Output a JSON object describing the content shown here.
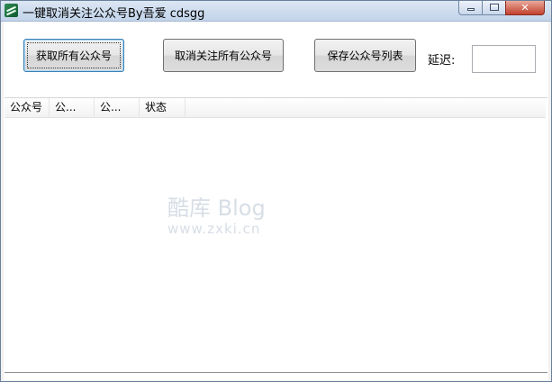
{
  "window": {
    "title": "一键取消关注公众号By吾爱 cdsgg",
    "controls": {
      "minimize": "minimize",
      "maximize": "maximize",
      "close": "close"
    }
  },
  "toolbar": {
    "fetch_button": "获取所有公众号",
    "unfollow_button": "取消关注所有公众号",
    "save_button": "保存公众号列表",
    "delay_label": "延迟:",
    "delay_value": ""
  },
  "list": {
    "columns": [
      "公众号",
      "公...",
      "公...",
      "状态"
    ],
    "rows": []
  },
  "watermark": {
    "brand": "酷库 Blog",
    "url": "www.zxki.cn"
  },
  "icons": {
    "app": "app-icon",
    "minimize": "minimize-icon",
    "maximize": "maximize-icon",
    "close": "close-icon"
  }
}
